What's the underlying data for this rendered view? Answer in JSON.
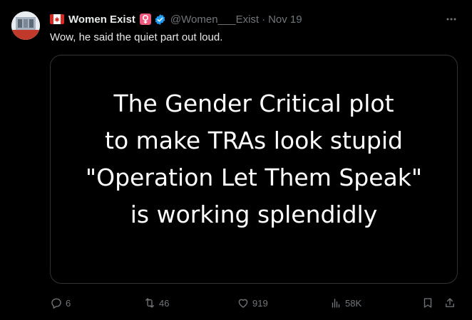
{
  "tweet": {
    "display_name": "Women Exist",
    "handle": "@Women___Exist",
    "separator": "·",
    "timestamp": "Nov 19",
    "text": "Wow, he said the quiet part out loud.",
    "more_icon": "ellipsis-icon"
  },
  "media": {
    "lines": [
      "The Gender Critical plot",
      "to make TRAs look stupid",
      "\"Operation Let Them Speak\"",
      "is working splendidly"
    ]
  },
  "actions": {
    "replies": "6",
    "reposts": "46",
    "likes": "919",
    "views": "58K"
  },
  "colors": {
    "background": "#000000",
    "text": "#e7e9ea",
    "muted": "#71767b",
    "verified": "#1d9bf0",
    "venus_badge": "#f0587e",
    "flag_red": "#d52b1e"
  }
}
